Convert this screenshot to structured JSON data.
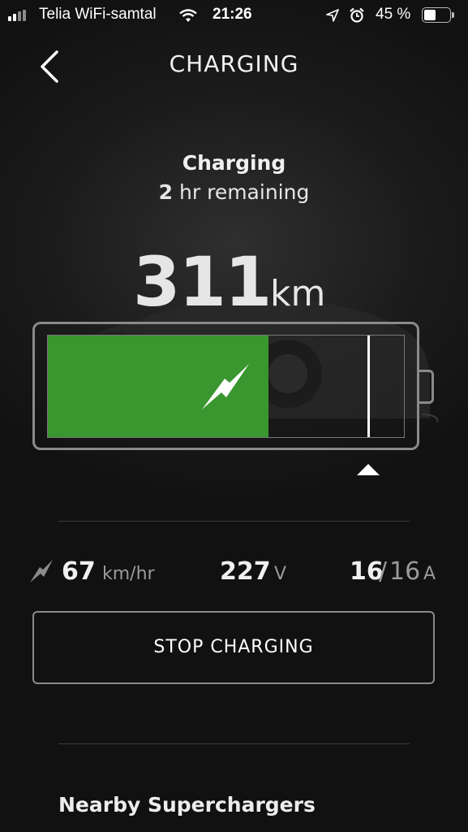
{
  "status_bar": {
    "carrier": "Telia WiFi-samtal",
    "time": "21:26",
    "battery_percent": "45 %",
    "battery_level": 0.45,
    "icons": [
      "signal-icon",
      "wifi-icon",
      "location-icon",
      "alarm-icon",
      "battery-icon"
    ]
  },
  "header": {
    "title": "CHARGING",
    "back_icon": "chevron-left-icon"
  },
  "charge_status": {
    "title": "Charging",
    "remaining_hours": "2",
    "remaining_text": "hr remaining"
  },
  "range": {
    "value": "311",
    "unit": "km"
  },
  "battery": {
    "charge_level": 0.62,
    "charge_limit": 0.9,
    "fill_color": "#3a962f"
  },
  "stats": {
    "rate_value": "67",
    "rate_unit": "km/hr",
    "voltage_value": "227",
    "voltage_unit": "V",
    "current_value": "16",
    "current_separator": "/",
    "current_max": "16",
    "current_unit": "A"
  },
  "actions": {
    "stop_label": "STOP CHARGING"
  },
  "nearby": {
    "heading": "Nearby Superchargers"
  }
}
